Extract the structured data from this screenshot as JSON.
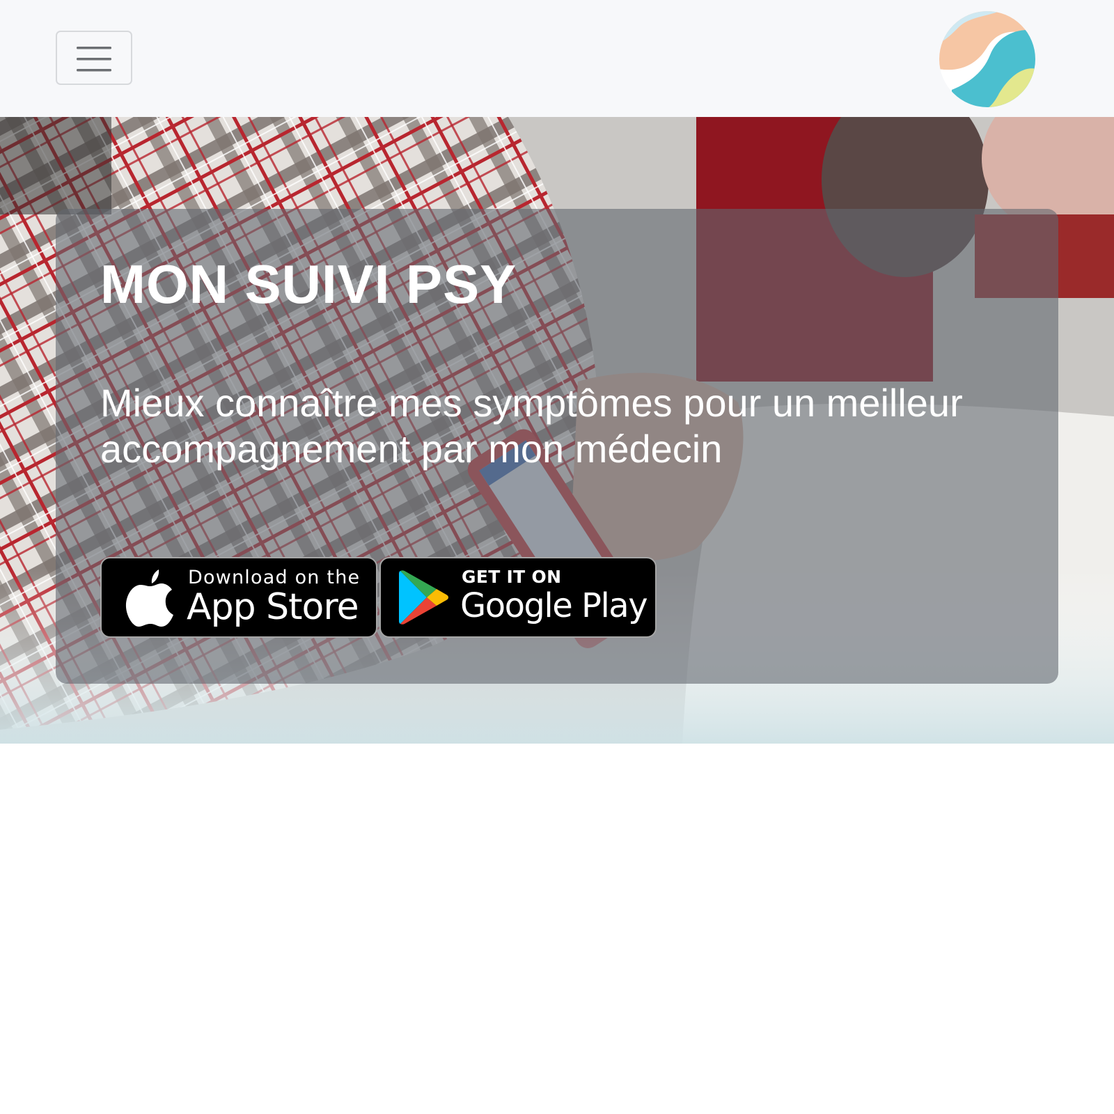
{
  "navbar": {
    "toggle_label": "Toggle navigation",
    "menu_icon": "hamburger-menu-icon",
    "logo": "logo-icon",
    "background": "#f7f8fa"
  },
  "hero": {
    "title": "MON SUIVI PSY",
    "subtitle": "Mieux connaître mes symptômes pour un meilleur accompagnement par mon médecin",
    "background_image": "person-holding-smartphone-photo",
    "badges": [
      {
        "icon": "apple-icon",
        "small": "Download on the",
        "big": "App Store"
      },
      {
        "icon": "google-play-icon",
        "small": "GET IT ON",
        "big": "Google Play"
      }
    ]
  },
  "colors": {
    "logo_blue": "#4bbfcf",
    "logo_peach": "#f6c6a4",
    "logo_light_blue": "#cfe9f2",
    "logo_lime": "#e3e88e",
    "badge_bg": "#000000",
    "badge_border": "#a6a6a6"
  }
}
